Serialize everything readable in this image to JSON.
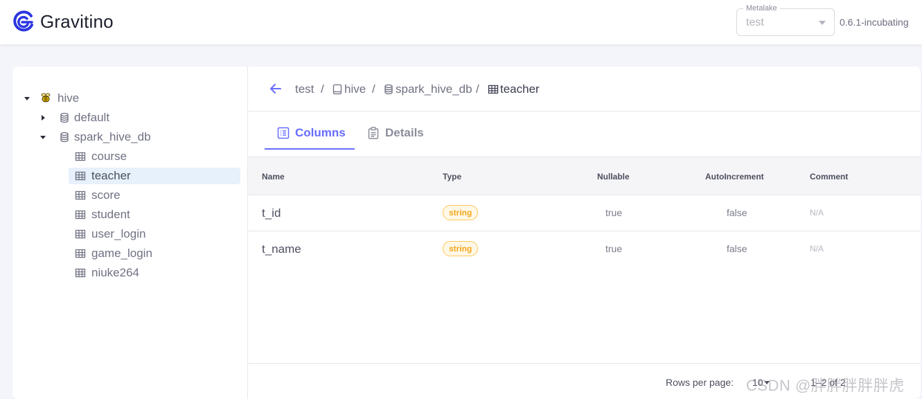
{
  "header": {
    "app_name": "Gravitino",
    "metalake": {
      "label": "Metalake",
      "value": "test"
    },
    "version": "0.6.1-incubating"
  },
  "tree": {
    "root": {
      "label": "hive",
      "icon": "hive-bee-icon",
      "expanded": true
    },
    "schemas": [
      {
        "label": "default",
        "expanded": false
      },
      {
        "label": "spark_hive_db",
        "expanded": true
      }
    ],
    "tables": [
      "course",
      "teacher",
      "score",
      "student",
      "user_login",
      "game_login",
      "niuke264"
    ],
    "selected": "teacher"
  },
  "breadcrumb": {
    "items": [
      "test",
      "hive",
      "spark_hive_db",
      "teacher"
    ],
    "separator": "/"
  },
  "tabs": [
    {
      "label": "Columns",
      "active": true,
      "icon": "list-icon"
    },
    {
      "label": "Details",
      "active": false,
      "icon": "clipboard-icon"
    }
  ],
  "table": {
    "headers": [
      "Name",
      "Type",
      "Nullable",
      "AutoIncrement",
      "Comment"
    ],
    "rows": [
      {
        "name": "t_id",
        "type": "string",
        "nullable": "true",
        "auto_increment": "false",
        "comment": "N/A"
      },
      {
        "name": "t_name",
        "type": "string",
        "nullable": "true",
        "auto_increment": "false",
        "comment": "N/A"
      }
    ]
  },
  "pagination": {
    "rows_label": "Rows per page:",
    "rows_value": "10",
    "range": "1–2 of 2"
  },
  "watermark": "CSDN @胖胖胖胖胖虎",
  "colors": {
    "accent": "#666cff",
    "badge_border": "#fdc657",
    "badge_text": "#f3a71c",
    "selected_bg": "#e6f1fc"
  }
}
